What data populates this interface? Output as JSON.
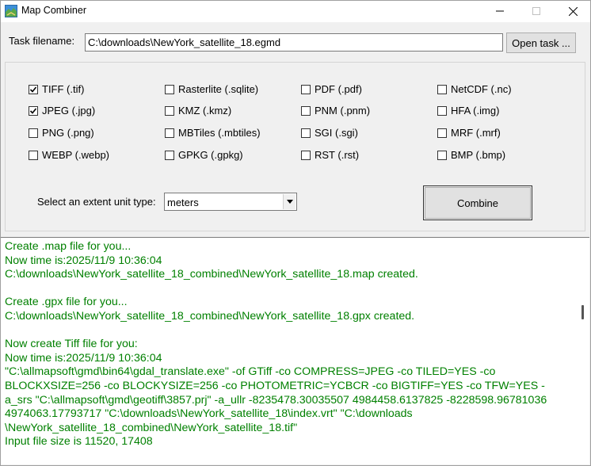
{
  "window": {
    "title": "Map Combiner",
    "icon": "map-icon"
  },
  "task": {
    "label": "Task filename:",
    "value": "C:\\downloads\\NewYork_satellite_18.egmd",
    "open_button": "Open task ..."
  },
  "formats": [
    {
      "label": "TIFF (.tif)",
      "checked": true
    },
    {
      "label": "JPEG (.jpg)",
      "checked": true
    },
    {
      "label": "PNG (.png)",
      "checked": false
    },
    {
      "label": "WEBP (.webp)",
      "checked": false
    },
    {
      "label": "Rasterlite (.sqlite)",
      "checked": false
    },
    {
      "label": "KMZ (.kmz)",
      "checked": false
    },
    {
      "label": "MBTiles (.mbtiles)",
      "checked": false
    },
    {
      "label": "GPKG (.gpkg)",
      "checked": false
    },
    {
      "label": "PDF (.pdf)",
      "checked": false
    },
    {
      "label": "PNM (.pnm)",
      "checked": false
    },
    {
      "label": "SGI (.sgi)",
      "checked": false
    },
    {
      "label": "RST (.rst)",
      "checked": false
    },
    {
      "label": "NetCDF (.nc)",
      "checked": false
    },
    {
      "label": "HFA (.img)",
      "checked": false
    },
    {
      "label": "MRF (.mrf)",
      "checked": false
    },
    {
      "label": "BMP (.bmp)",
      "checked": false
    }
  ],
  "extent": {
    "label": "Select an extent unit type:",
    "value": "meters"
  },
  "combine_button": "Combine",
  "log_lines": [
    "Create .map file for you...",
    "Now time is:2025/11/9 10:36:04",
    "C:\\downloads\\NewYork_satellite_18_combined\\NewYork_satellite_18.map created.",
    "",
    "Create .gpx file for you...",
    "C:\\downloads\\NewYork_satellite_18_combined\\NewYork_satellite_18.gpx created.",
    "",
    "Now create Tiff file for you:",
    "Now time is:2025/11/9 10:36:04",
    "\"C:\\allmapsoft\\gmd\\bin64\\gdal_translate.exe\" -of GTiff -co COMPRESS=JPEG -co TILED=YES -co",
    "BLOCKXSIZE=256 -co BLOCKYSIZE=256 -co PHOTOMETRIC=YCBCR  -co BIGTIFF=YES -co TFW=YES -",
    "a_srs \"C:\\allmapsoft\\gmd\\geotiff\\3857.prj\" -a_ullr -8235478.30035507 4984458.6137825 -8228598.96781036",
    "4974063.17793717 \"C:\\downloads\\NewYork_satellite_18\\index.vrt\" \"C:\\downloads",
    "\\NewYork_satellite_18_combined\\NewYork_satellite_18.tif\"",
    "Input file size is 11520, 17408"
  ],
  "colors": {
    "log_text": "#008000"
  }
}
